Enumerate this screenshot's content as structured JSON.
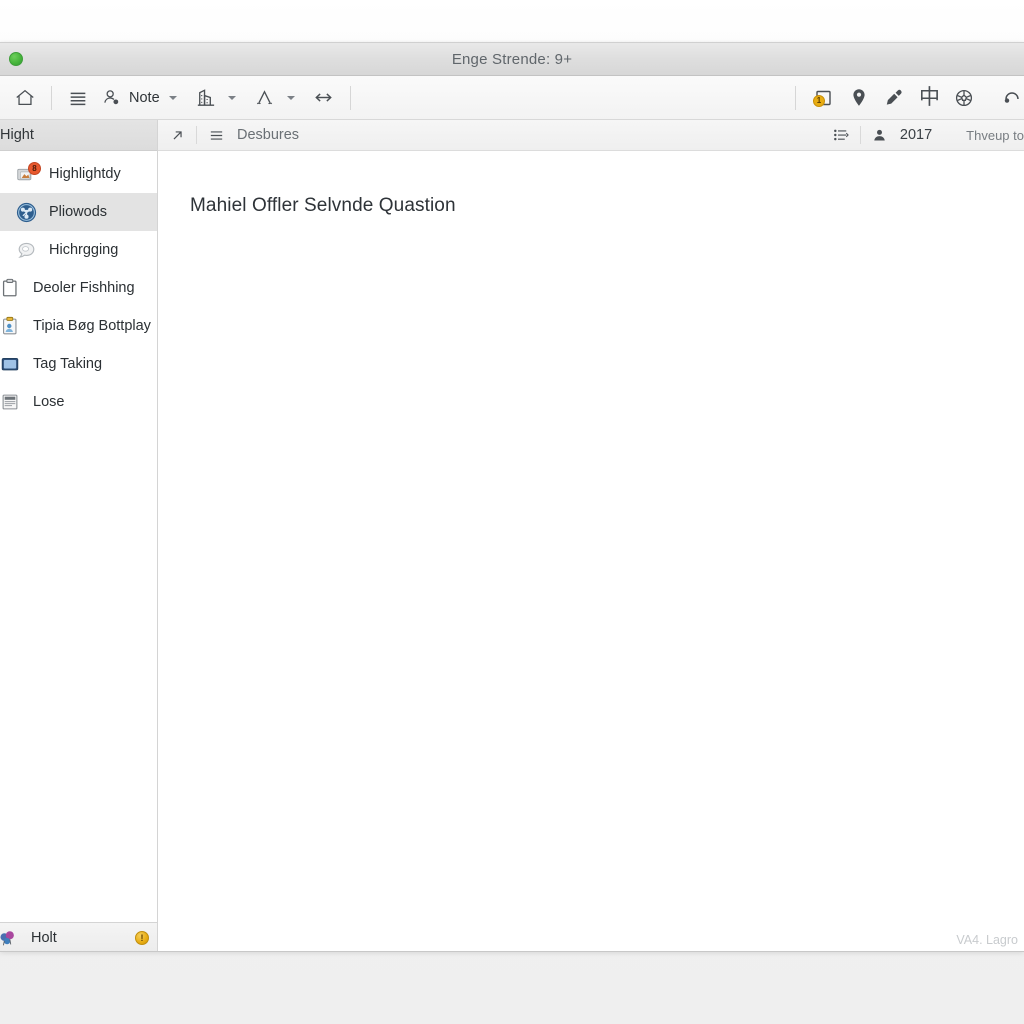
{
  "window": {
    "title": "Enge Strende: 9+",
    "traffic_light": "green-close-button"
  },
  "toolbar": {
    "left": [
      {
        "name": "home-icon",
        "label": ""
      },
      {
        "name": "list-lines-icon",
        "label": ""
      },
      {
        "name": "person-search-icon",
        "label": "Note"
      },
      {
        "name": "chart-building-icon",
        "label": ""
      },
      {
        "name": "text-format-a-icon",
        "label": ""
      },
      {
        "name": "double-arrow-icon",
        "label": ""
      }
    ],
    "note_label": "Note",
    "right": [
      {
        "name": "window-badge-icon",
        "badge": "1"
      },
      {
        "name": "map-pin-icon",
        "badge": ""
      },
      {
        "name": "marker-pen-icon",
        "badge": ""
      },
      {
        "name": "cjk-character-icon",
        "glyph": "中"
      },
      {
        "name": "flower-web-icon",
        "badge": ""
      },
      {
        "name": "partial-cut-icon",
        "badge": ""
      }
    ]
  },
  "sidebar": {
    "header": "Hight",
    "items": [
      {
        "label": "Highlightdy",
        "icon": "card-badge-icon",
        "badge": "8",
        "selected": false
      },
      {
        "label": "Pliowods",
        "icon": "network-circle-icon",
        "badge": "",
        "selected": true
      },
      {
        "label": "Hichrgging",
        "icon": "speech-bubble-icon",
        "badge": "",
        "selected": false
      },
      {
        "label": "Deoler Fishhing",
        "icon": "clipboard-icon",
        "badge": "",
        "selected": false
      },
      {
        "label": "Tipia Bøg Bottplay",
        "icon": "clipboard-user-icon",
        "badge": "",
        "selected": false
      },
      {
        "label": "Tag Taking",
        "icon": "blue-screen-icon",
        "badge": "",
        "selected": false
      },
      {
        "label": "Lose",
        "icon": "document-lines-icon",
        "badge": "",
        "selected": false
      }
    ],
    "footer": {
      "label": "Holt",
      "icon": "colorful-balloons-icon",
      "badge": "!"
    }
  },
  "content_header": {
    "expand_icon": "diagonal-arrow-icon",
    "menu_icon": "hamburger-icon",
    "title": "Desbures",
    "list_icon": "ordered-list-icon",
    "person_icon": "person-icon",
    "year": "2017",
    "tail_text": "Thveup to "
  },
  "document": {
    "heading": "Mahiel Offler Selvnde Quastion",
    "footer_note": "VA4. Lagro"
  },
  "colors": {
    "accent_orange": "#e8ac12",
    "badge_red": "#e8592e",
    "selected_row": "#e3e3e3",
    "titlebar": "#dedede",
    "green_light": "#45b33a"
  }
}
